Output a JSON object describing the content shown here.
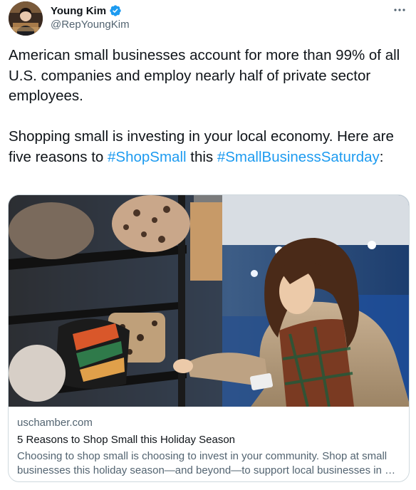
{
  "tweet": {
    "author": {
      "name": "Young Kim",
      "handle": "@RepYoungKim",
      "verified": true,
      "avatar": "avatar-photo"
    },
    "more_icon": "ellipsis-icon",
    "text": {
      "line1": "American small businesses account for more than 99% of all U.S. companies and employ nearly half of private sector employees.",
      "line2_pre": "Shopping small is investing in your local economy. Here are five reasons to ",
      "hashtag1": "#ShopSmall",
      "line2_mid": " this ",
      "hashtag2": "#SmallBusinessSaturday",
      "line2_post": ":"
    },
    "link_card": {
      "image": "photo-woman-shopping-handbags",
      "domain": "uschamber.com",
      "title": "5 Reasons to Shop Small this Holiday Season",
      "description": "Choosing to shop small is choosing to invest in your community. Shop at small businesses this holiday season—and beyond—to support local businesses in …"
    }
  },
  "colors": {
    "text": "#0f1419",
    "secondary": "#536471",
    "link": "#1d9bf0",
    "border": "#cfd9de"
  }
}
